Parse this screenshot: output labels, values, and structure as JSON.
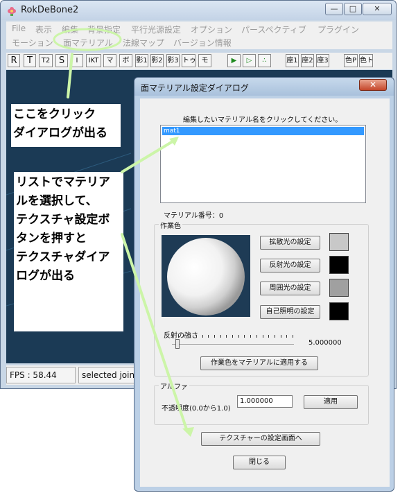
{
  "main_window": {
    "title": "RokDeBone2",
    "controls": {
      "minimize": "—",
      "maximize": "□",
      "close": "✕"
    },
    "menu_row1": [
      "File",
      "表示",
      "編集",
      "背景指定",
      "平行光源設定",
      "オプション",
      "パースペクティブ",
      "プラグイン"
    ],
    "menu_row2": [
      "モーション",
      "面マテリアル",
      "法線マップ",
      "バージョン情報"
    ],
    "toolbar": [
      "R",
      "T",
      "T2",
      "S",
      "I",
      "IKT",
      "マ",
      "ボ",
      "影1",
      "影2",
      "影3",
      "トゥ",
      "モ",
      "▶",
      "▷",
      "∴",
      "座1",
      "座2",
      "座3",
      "色P",
      "色ト"
    ],
    "status": {
      "fps": "FPS : 58.44",
      "selection": "selected joint"
    }
  },
  "annotations": {
    "note1_lines": [
      "ここをクリック",
      "ダイアログが出る"
    ],
    "note2_lines": [
      "リストでマテリア",
      "ルを選択して、",
      "テクスチャ設定ボ",
      "タンを押すと",
      "テクスチャダイア",
      "ログが出る"
    ],
    "accent_color": "#ccf5a8"
  },
  "dialog": {
    "title": "面マテリアル設定ダイアログ",
    "close_label": "✕",
    "instruction": "編集したいマテリアル名をクリックしてください。",
    "materials": [
      "mat1"
    ],
    "material_number": "マテリアル番号：0",
    "work_color": {
      "group_label": "作業色",
      "diffuse_button": "拡散光の設定",
      "specular_button": "反射光の設定",
      "ambient_button": "周囲光の設定",
      "emissive_button": "自己照明の設定",
      "swatches": {
        "diffuse": "#c8c8c8",
        "specular": "#000000",
        "ambient": "#a0a0a0",
        "emissive": "#000000"
      },
      "preview_bg": "#1e3b55",
      "shininess_label": "反射の強さ",
      "shininess_value": "5.000000",
      "shininess_fraction": 0.03,
      "apply_button": "作業色をマテリアルに適用する"
    },
    "alpha": {
      "group_label": "アルファ",
      "opacity_label": "不透明度(0.0から1.0)",
      "opacity_value": "1.000000",
      "apply_button": "適用"
    },
    "texture_button": "テクスチャーの設定画面へ",
    "close_button": "閉じる"
  }
}
